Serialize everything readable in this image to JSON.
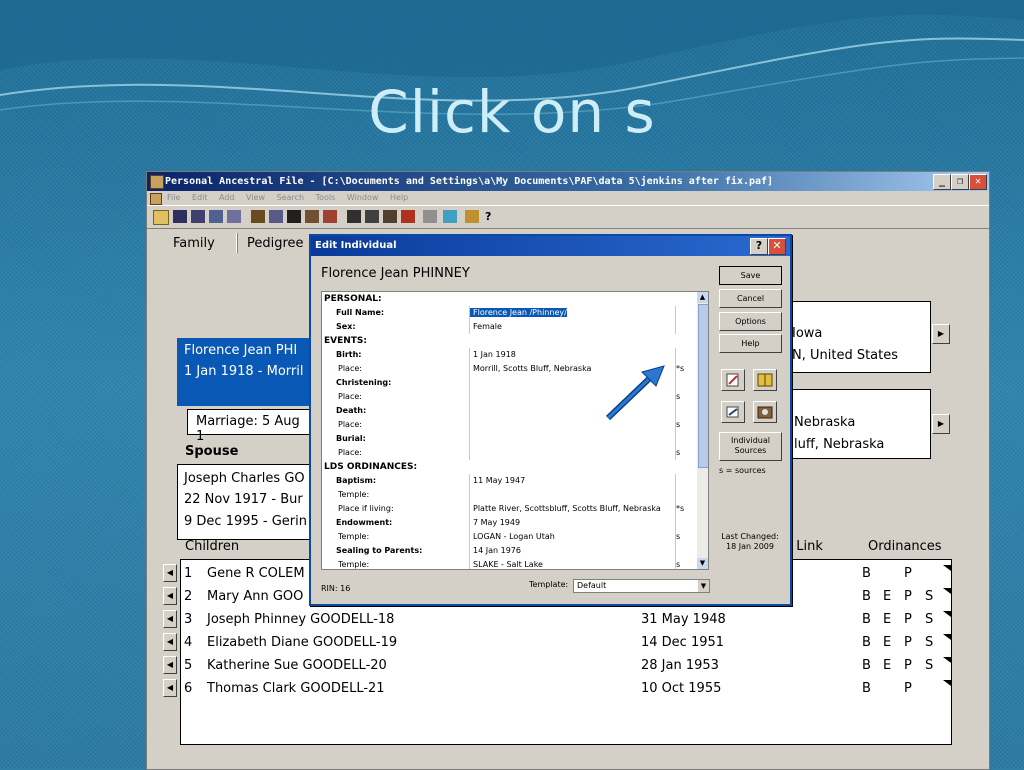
{
  "slide": {
    "title": "Click on s"
  },
  "app": {
    "title": "Personal Ancestral File - [C:\\Documents and Settings\\a\\My Documents\\PAF\\data 5\\jenkins after fix.paf]",
    "menu": [
      "File",
      "Edit",
      "Add",
      "View",
      "Search",
      "Tools",
      "Window",
      "Help"
    ],
    "tabs": [
      "Family",
      "Pedigree"
    ]
  },
  "family": {
    "husband": {
      "name": "Florence Jean PHI",
      "dates": "1 Jan 1918 - Morril"
    },
    "parent1": {
      "line1": "Iowa",
      "line2": "N, United States"
    },
    "parent2": {
      "line1": "Nebraska",
      "line2": "luff, Nebraska"
    },
    "marriage": "Marriage: 5 Aug 1",
    "spouse_label": "Spouse",
    "spouse": {
      "name": "Joseph Charles GO",
      "born": "22 Nov 1917 - Bur",
      "died": "9 Dec 1995 - Gerin"
    },
    "children_label": "Children",
    "link_label": "t Link",
    "ordinances_label": "Ordinances",
    "children": [
      {
        "num": "1",
        "name": "Gene R COLEM",
        "date": "",
        "ord": [
          "B",
          "",
          "P",
          ""
        ]
      },
      {
        "num": "2",
        "name": "Mary Ann GOO",
        "date": "",
        "ord": [
          "B",
          "E",
          "P",
          "S"
        ]
      },
      {
        "num": "3",
        "name": "Joseph Phinney GOODELL-18",
        "date": "31 May 1948",
        "ord": [
          "B",
          "E",
          "P",
          "S"
        ]
      },
      {
        "num": "4",
        "name": "Elizabeth Diane GOODELL-19",
        "date": "14 Dec 1951",
        "ord": [
          "B",
          "E",
          "P",
          "S"
        ]
      },
      {
        "num": "5",
        "name": "Katherine Sue GOODELL-20",
        "date": "28 Jan 1953",
        "ord": [
          "B",
          "E",
          "P",
          "S"
        ]
      },
      {
        "num": "6",
        "name": "Thomas Clark GOODELL-21",
        "date": "10 Oct 1955",
        "ord": [
          "B",
          "",
          "P",
          ""
        ]
      }
    ]
  },
  "dialog": {
    "title": "Edit Individual",
    "person_name": "Florence Jean PHINNEY",
    "rows": [
      {
        "label": "PERSONAL:",
        "value": "",
        "s": "",
        "header": true
      },
      {
        "label": "Full Name:",
        "value": "Florence Jean /Phinney/",
        "s": "",
        "bold": true
      },
      {
        "label": "Sex:",
        "value": "Female",
        "s": "",
        "bold": true
      },
      {
        "label": "EVENTS:",
        "value": "",
        "s": "",
        "header": true
      },
      {
        "label": "Birth:",
        "value": "1 Jan 1918",
        "s": "",
        "bold": true
      },
      {
        "label": "Place:",
        "value": "Morrill, Scotts Bluff, Nebraska",
        "s": "*s"
      },
      {
        "label": "Christening:",
        "value": "",
        "s": "",
        "bold": true
      },
      {
        "label": "Place:",
        "value": "",
        "s": "s"
      },
      {
        "label": "Death:",
        "value": "",
        "s": "",
        "bold": true
      },
      {
        "label": "Place:",
        "value": "",
        "s": "s"
      },
      {
        "label": "Burial:",
        "value": "",
        "s": "",
        "bold": true
      },
      {
        "label": "Place:",
        "value": "",
        "s": "s"
      },
      {
        "label": "LDS ORDINANCES:",
        "value": "",
        "s": "",
        "header": true
      },
      {
        "label": "Baptism:",
        "value": "11 May 1947",
        "s": "",
        "bold": true
      },
      {
        "label": "Temple:",
        "value": "",
        "s": ""
      },
      {
        "label": "Place if living:",
        "value": "Platte River, Scottsbluff, Scotts Bluff, Nebraska",
        "s": "*s"
      },
      {
        "label": "Endowment:",
        "value": "7 May 1949",
        "s": "",
        "bold": true
      },
      {
        "label": "Temple:",
        "value": "LOGAN - Logan Utah",
        "s": "s"
      },
      {
        "label": "Sealing to Parents:",
        "value": "14 Jan 1976",
        "s": "",
        "bold": true
      },
      {
        "label": "Temple:",
        "value": "SLAKE - Salt Lake",
        "s": "s"
      }
    ],
    "buttons": {
      "save": "Save",
      "cancel": "Cancel",
      "options": "Options",
      "help": "Help",
      "sources_1": "Individual",
      "sources_2": "Sources"
    },
    "s_note": "s = sources",
    "last_changed_label": "Last Changed:",
    "last_changed_date": "18 Jan 2009",
    "rin": "RIN: 16",
    "template_label": "Template:",
    "template_value": "Default"
  },
  "colors": {
    "selection": "#0a58b5",
    "title_bar": "#0a246a",
    "arrow": "#1a5fb4"
  }
}
